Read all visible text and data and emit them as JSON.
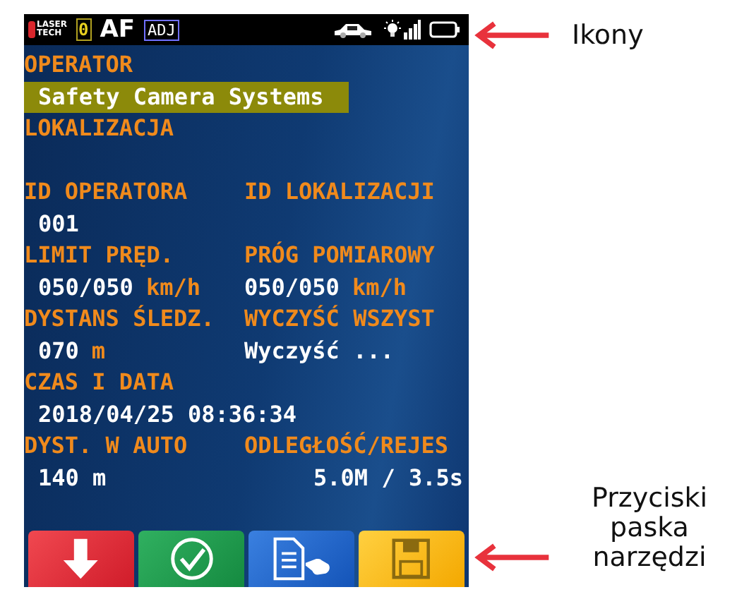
{
  "status_bar": {
    "logo": [
      "LASER",
      "TECH"
    ],
    "counter": "0",
    "mode": "AF",
    "adjust": "ADJ"
  },
  "rows": [
    {
      "kind": "label",
      "cells": [
        {
          "text": "OPERATOR"
        }
      ]
    },
    {
      "kind": "value",
      "selected": true,
      "cells": [
        {
          "text": "Safety Camera Systems"
        }
      ]
    },
    {
      "kind": "label",
      "cells": [
        {
          "text": "LOKALIZACJA"
        }
      ]
    },
    {
      "kind": "empty"
    },
    {
      "kind": "label",
      "cells": [
        {
          "text": "ID OPERATORA"
        },
        {
          "text": "ID LOKALIZACJI"
        }
      ]
    },
    {
      "kind": "value",
      "selected": false,
      "cells": [
        {
          "text": "001"
        }
      ]
    },
    {
      "kind": "label",
      "cells": [
        {
          "text": "LIMIT PRĘD."
        },
        {
          "text": "PRÓG POMIAROWY"
        }
      ]
    },
    {
      "kind": "value",
      "selected": false,
      "cells": [
        {
          "text": "050/050",
          "unit": "km/h"
        },
        {
          "text": "050/050",
          "unit": "km/h"
        }
      ]
    },
    {
      "kind": "label",
      "cells": [
        {
          "text": "DYSTANS ŚLEDZ."
        },
        {
          "text": "WYCZYŚĆ WSZYST"
        }
      ]
    },
    {
      "kind": "value",
      "selected": false,
      "cells": [
        {
          "text": "070",
          "unit": "m"
        },
        {
          "text": "Wyczyść ..."
        }
      ]
    },
    {
      "kind": "label",
      "cells": [
        {
          "text": "CZAS I DATA"
        }
      ]
    },
    {
      "kind": "value",
      "selected": false,
      "cells": [
        {
          "text": "2018/04/25 08:36:34"
        }
      ]
    },
    {
      "kind": "label",
      "cells": [
        {
          "text": "DYST. W AUTO"
        },
        {
          "text": "ODLEGŁOŚĆ/REJES"
        }
      ]
    },
    {
      "kind": "value",
      "selected": false,
      "cells": [
        {
          "text": "140 m"
        },
        {
          "text": "5.0M / 3.5s",
          "right_aligned": true
        }
      ]
    }
  ],
  "toolbar": [
    {
      "kind": "down"
    },
    {
      "kind": "confirm"
    },
    {
      "kind": "document"
    },
    {
      "kind": "save"
    }
  ],
  "annotations": [
    {
      "text": "Ikony"
    },
    {
      "text": "Przyciski paska narzędzi"
    }
  ]
}
